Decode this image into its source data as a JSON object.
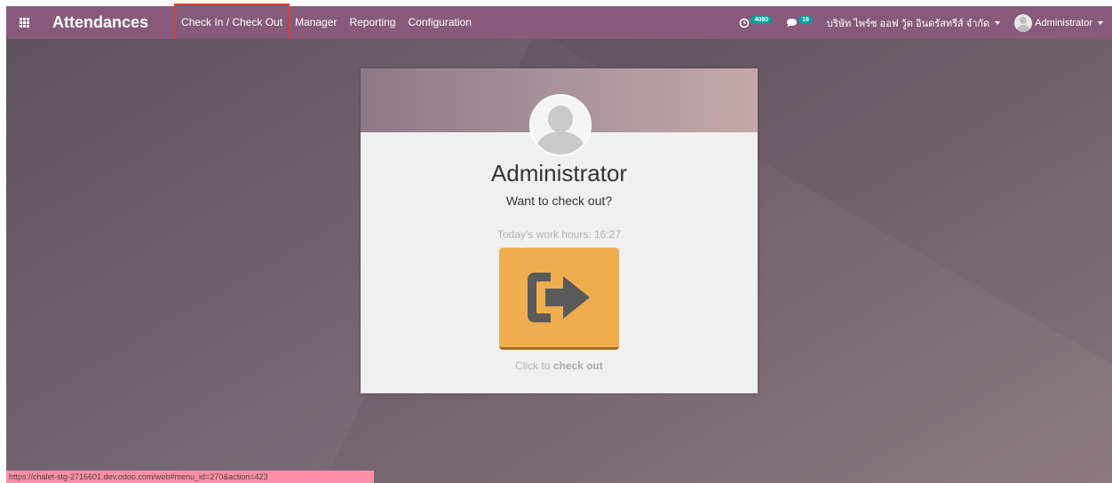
{
  "app": {
    "title": "Attendances"
  },
  "menu": {
    "items": [
      {
        "label": "Check In / Check Out",
        "active": true
      },
      {
        "label": "Manager"
      },
      {
        "label": "Reporting"
      },
      {
        "label": "Configuration"
      }
    ]
  },
  "systray": {
    "activity_badge": "4080",
    "messages_badge": "16",
    "company": "บริษัท ไพร์ซ ออฟ วู้ด อินดรัสทรีส์ จำกัด",
    "user": "Administrator"
  },
  "card": {
    "employee_name": "Administrator",
    "question": "Want to check out?",
    "work_hours": "Today's work hours: 16:27",
    "click_prefix": "Click to",
    "click_action": "check out"
  },
  "status_bar": {
    "url": "https://chalet-stg-2716601.dev.odoo.com/web#menu_id=270&action=423"
  },
  "colors": {
    "navbar": "#875a7b",
    "button": "#f0ad4e",
    "badge": "#00a09d",
    "highlight": "#d0413b"
  },
  "icons": {
    "apps": "apps-grid-icon",
    "activity": "clock-icon",
    "messages": "chat-icon",
    "checkout": "sign-out-icon"
  }
}
